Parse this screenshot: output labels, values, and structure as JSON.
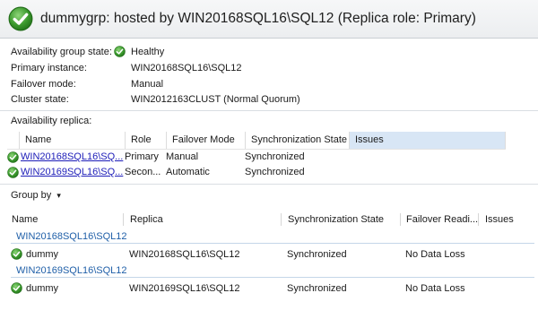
{
  "header": {
    "title": "dummygrp: hosted by WIN20168SQL16\\SQL12 (Replica role: Primary)",
    "icon": "status-ok-icon"
  },
  "properties": [
    {
      "label": "Availability group state:",
      "value": "Healthy",
      "icon": "status-ok-icon"
    },
    {
      "label": "Primary instance:",
      "value": "WIN20168SQL16\\SQL12"
    },
    {
      "label": "Failover mode:",
      "value": "Manual"
    },
    {
      "label": "Cluster state:",
      "value": "WIN2012163CLUST (Normal Quorum)"
    }
  ],
  "replicas": {
    "section_label": "Availability replica:",
    "columns": [
      "Name",
      "Role",
      "Failover Mode",
      "Synchronization State",
      "Issues"
    ],
    "rows": [
      {
        "name": "WIN20168SQL16\\SQ...",
        "role": "Primary",
        "failover": "Manual",
        "sync": "Synchronized",
        "issues": ""
      },
      {
        "name": "WIN20169SQL16\\SQ...",
        "role": "Secon...",
        "failover": "Automatic",
        "sync": "Synchronized",
        "issues": ""
      }
    ]
  },
  "group_by": {
    "label": "Group by",
    "caret": "▾"
  },
  "databases": {
    "columns": [
      "Name",
      "Replica",
      "Synchronization State",
      "Failover Readi...",
      "Issues"
    ],
    "groups": [
      {
        "title": "WIN20168SQL16\\SQL12",
        "rows": [
          {
            "name": "dummy",
            "replica": "WIN20168SQL16\\SQL12",
            "sync": "Synchronized",
            "failover": "No Data Loss",
            "issues": ""
          }
        ]
      },
      {
        "title": "WIN20169SQL16\\SQL12",
        "rows": [
          {
            "name": "dummy",
            "replica": "WIN20169SQL16\\SQL12",
            "sync": "Synchronized",
            "failover": "No Data Loss",
            "issues": ""
          }
        ]
      }
    ]
  },
  "colors": {
    "ok_green": "#3c9a2e",
    "link": "#1c1cb8",
    "group_title": "#1f5fa8",
    "selected_column": "#d8e6f5"
  }
}
